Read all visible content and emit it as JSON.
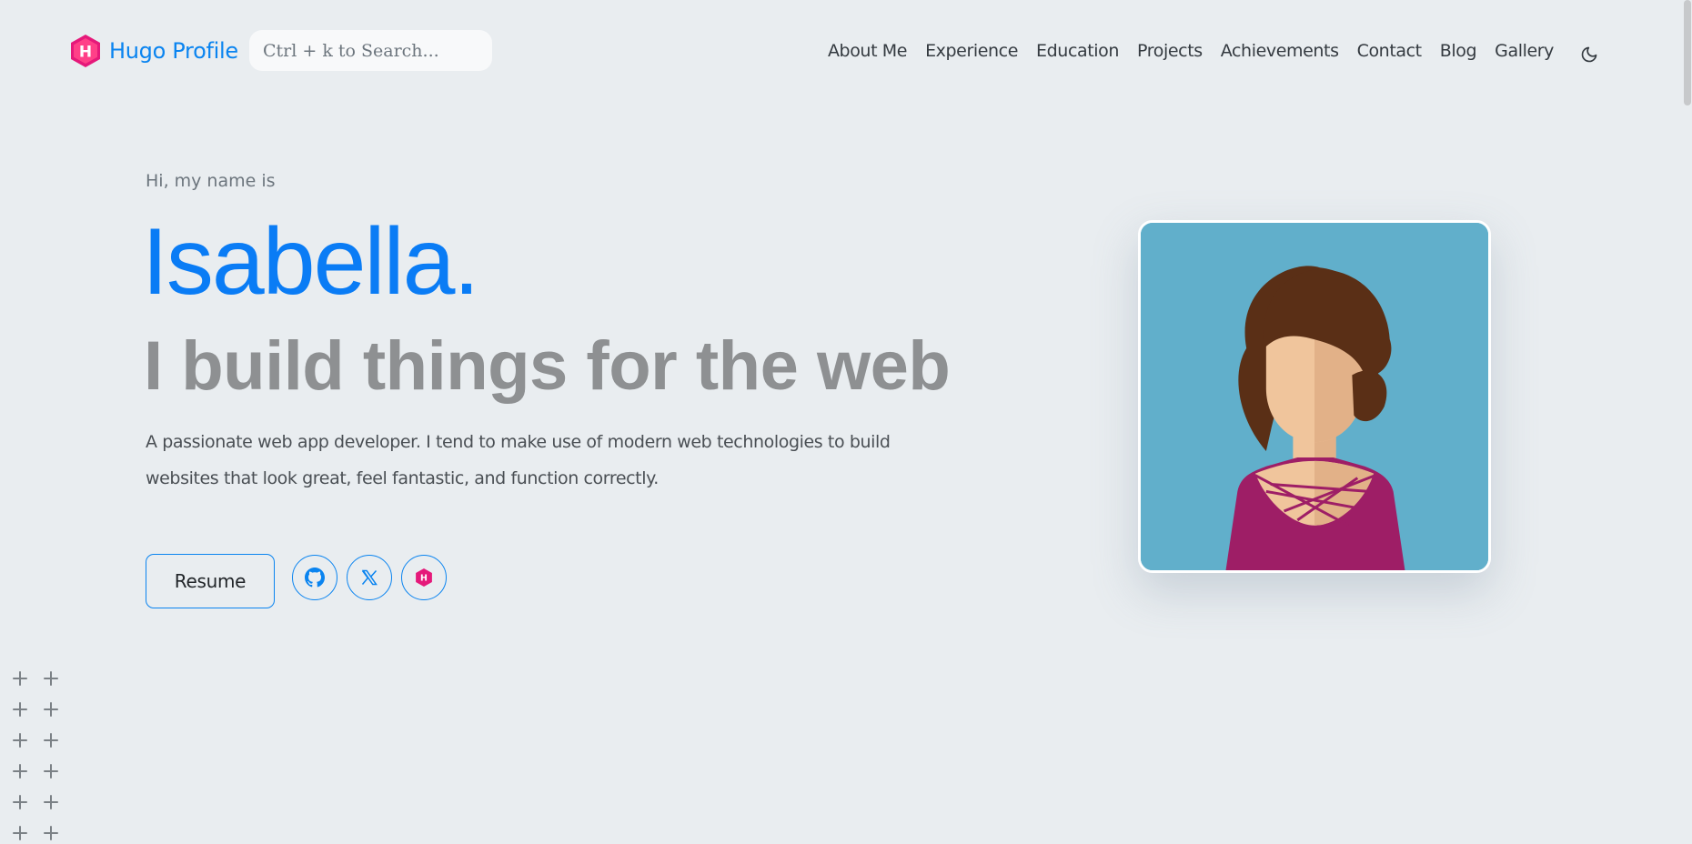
{
  "brand": {
    "name": "Hugo Profile",
    "logo_letter": "H",
    "logo_color": "#e5197a"
  },
  "search": {
    "placeholder": "Ctrl + k to Search..."
  },
  "nav": {
    "items": [
      {
        "label": "About Me"
      },
      {
        "label": "Experience"
      },
      {
        "label": "Education"
      },
      {
        "label": "Projects"
      },
      {
        "label": "Achievements"
      },
      {
        "label": "Contact"
      },
      {
        "label": "Blog"
      },
      {
        "label": "Gallery"
      }
    ],
    "theme_toggle_icon": "moon-icon"
  },
  "hero": {
    "greeting": "Hi, my name is",
    "name": "Isabella.",
    "tagline": "I build things for the web",
    "description": "A passionate web app developer. I tend to make use of modern web technologies to build websites that look great, feel fantastic, and function correctly.",
    "resume_label": "Resume",
    "socials": [
      {
        "icon": "github-icon"
      },
      {
        "icon": "x-icon"
      },
      {
        "icon": "hugo-icon"
      }
    ]
  },
  "colors": {
    "accent": "#0a84f0",
    "background": "#e9edf0",
    "avatar_bg": "#61afcb",
    "hugo_pink": "#e5197a"
  }
}
